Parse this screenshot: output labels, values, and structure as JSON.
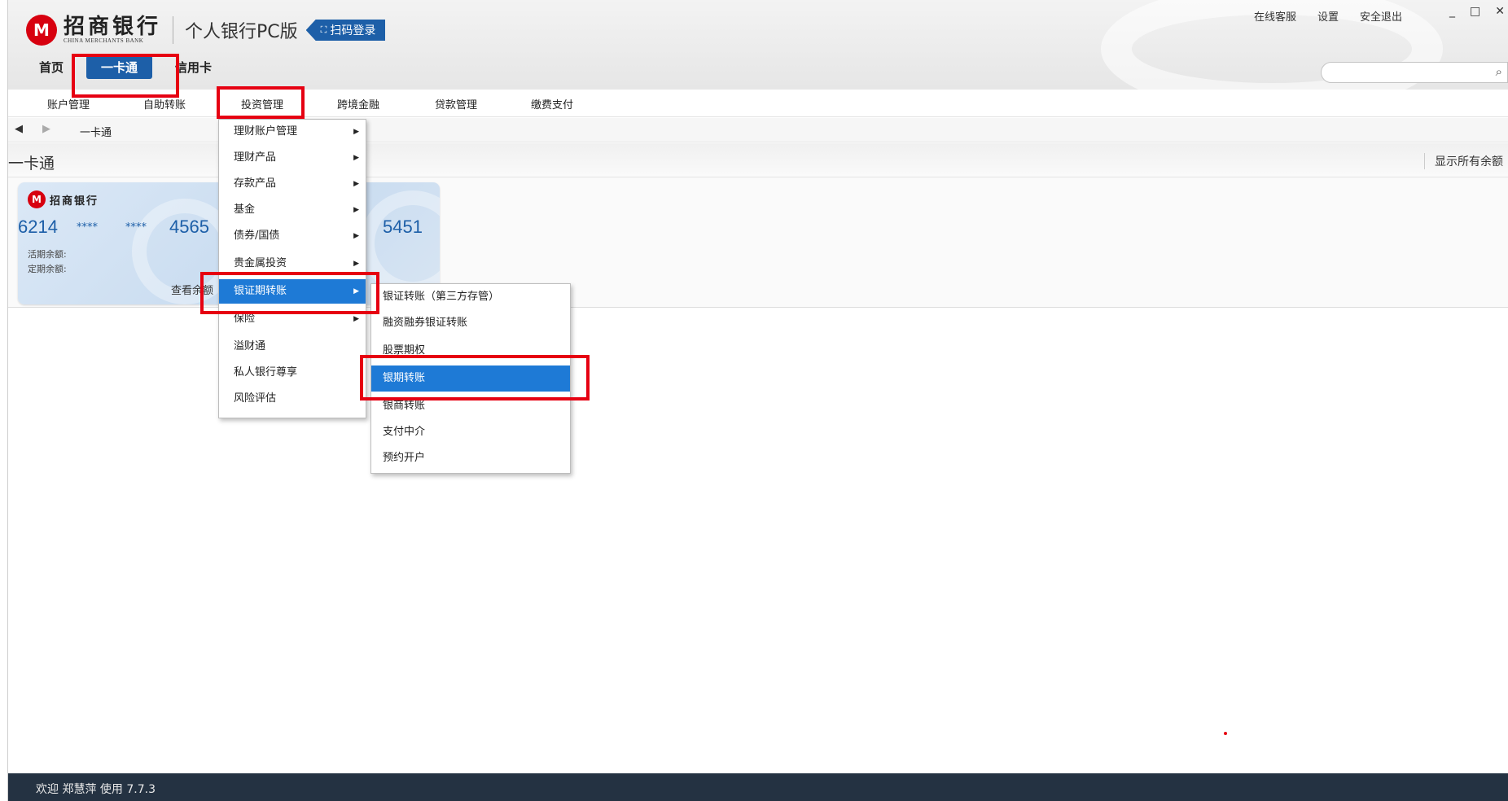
{
  "header": {
    "logo_cn": "招商银行",
    "logo_en": "CHINA MERCHANTS BANK",
    "app_title": "个人银行PC版",
    "scan_login": "扫码登录",
    "links": [
      "在线客服",
      "设置",
      "安全退出"
    ],
    "window_controls": [
      "_",
      "□",
      "✕"
    ]
  },
  "main_nav": [
    "首页",
    "一卡通",
    "信用卡"
  ],
  "sub_nav": [
    "账户管理",
    "自助转账",
    "投资管理",
    "跨境金融",
    "贷款管理",
    "缴费支付"
  ],
  "breadcrumb": "一卡通",
  "section": {
    "title": "一卡通",
    "show_all_balance": "显示所有余额"
  },
  "card": {
    "logo": "招商银行",
    "number_start": "6214",
    "mask1": "****",
    "mask2": "****",
    "number_mid": "4565",
    "number_end": "5451",
    "current_label": "活期余额:",
    "fixed_label": "定期余额:",
    "view_label": "查看余额"
  },
  "invest_menu": {
    "items": [
      {
        "label": "理财账户管理",
        "has_sub": true
      },
      {
        "label": "理财产品",
        "has_sub": true
      },
      {
        "label": "存款产品",
        "has_sub": true
      },
      {
        "label": "基金",
        "has_sub": true
      },
      {
        "label": "债券/国债",
        "has_sub": true
      },
      {
        "label": "贵金属投资",
        "has_sub": true
      },
      {
        "label": "银证期转账",
        "has_sub": true,
        "selected": true
      },
      {
        "label": "保险",
        "has_sub": true
      },
      {
        "label": "溢财通",
        "has_sub": false
      },
      {
        "label": "私人银行尊享",
        "has_sub": false
      },
      {
        "label": "风险评估",
        "has_sub": false
      }
    ]
  },
  "submenu": {
    "items": [
      {
        "label": "银证转账（第三方存管）"
      },
      {
        "label": "融资融券银证转账"
      },
      {
        "label": "股票期权"
      },
      {
        "label": "银期转账",
        "selected": true
      },
      {
        "label": "银商转账"
      },
      {
        "label": "支付中介"
      },
      {
        "label": "预约开户"
      }
    ]
  },
  "footer": {
    "welcome": "欢迎 郑慧萍 使用 7.7.3"
  },
  "colors": {
    "accent": "#1d5fa8",
    "menu_selected": "#1e7ad6",
    "highlight_box": "#e60012",
    "footer_bg": "#243242"
  }
}
